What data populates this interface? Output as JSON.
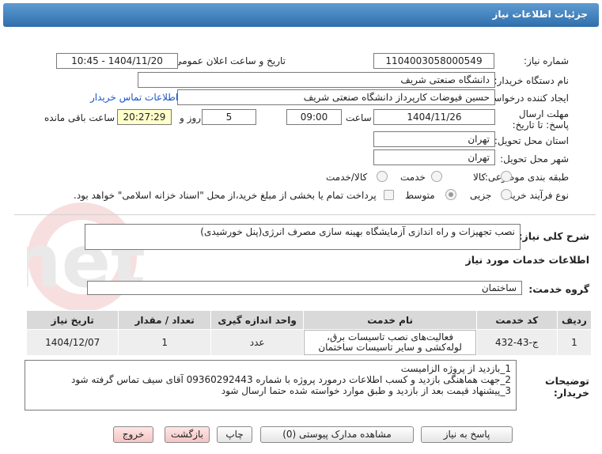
{
  "title": "جزئیات اطلاعات نیاز",
  "fields": {
    "need_number_label": "شماره نیاز:",
    "need_number": "1104003058000549",
    "announce_label": "تاریخ و ساعت اعلان عمومی:",
    "announce_value": "1404/11/20 - 10:45",
    "buyer_org_label": "نام دستگاه خریدار:",
    "buyer_org": "دانشگاه صنعتی شریف",
    "creator_label": "ایجاد کننده درخواست:",
    "creator": "حسین فیوضات کارپرداز دانشگاه صنعتی شریف",
    "contact_link": "اطلاعات تماس خریدار",
    "deadline_label": "مهلت ارسال پاسخ: تا تاریخ:",
    "deadline_date": "1404/11/26",
    "time_label": "ساعت",
    "deadline_time": "09:00",
    "days_value": "5",
    "days_label": "روز و",
    "remaining_time": "20:27:29",
    "remaining_label": "ساعت باقی مانده",
    "province_label": "استان محل تحویل:",
    "province": "تهران",
    "city_label": "شهر محل تحویل:",
    "city": "تهران",
    "category_label": "طبقه بندی موضوعی:",
    "category_options": [
      "کالا",
      "خدمت",
      "کالا/خدمت"
    ],
    "process_label": "نوع فرآیند خرید :",
    "process_options": [
      "جزیی",
      "متوسط"
    ],
    "payment_text": "پرداخت تمام یا بخشی از مبلغ خرید،از محل \"اسناد خزانه اسلامی\" خواهد بود."
  },
  "summary": {
    "label": "شرح کلی نیاز:",
    "value": "نصب تجهیزات و راه اندازی آزمایشگاه بهینه سازی مصرف انرژی(پنل خورشیدی)"
  },
  "services_heading": "اطلاعات خدمات مورد نیاز",
  "service_group": {
    "label": "گروه خدمت:",
    "value": "ساختمان"
  },
  "table": {
    "headers": [
      "ردیف",
      "کد خدمت",
      "نام خدمت",
      "واحد اندازه گیری",
      "تعداد / مقدار",
      "تاریخ نیاز"
    ],
    "rows": [
      [
        "1",
        "ج-43-432",
        "فعالیت‌های نصب تاسیسات برق، لوله‌کشی و سایر تاسیسات ساختمان",
        "عدد",
        "1",
        "1404/12/07"
      ]
    ]
  },
  "notes": {
    "label": "توضیحات خریدار:",
    "lines": [
      "1_بازدید از پروژه الزامیست",
      "2_جهت هماهنگی بازدید و کسب اطلاعات درمورد پروژه با شماره 09360292443 آقای سیف تماس گرفته شود",
      "3_پیشنهاد قیمت بعد از بازدید و طبق موارد خواسته شده حتما ارسال شود"
    ]
  },
  "buttons": {
    "reply": "پاسخ به نیاز",
    "docs": "مشاهده مدارک پیوستی (0)",
    "print": "چاپ",
    "back": "بازگشت",
    "exit": "خروج"
  },
  "watermark": "AriaTender.net"
}
